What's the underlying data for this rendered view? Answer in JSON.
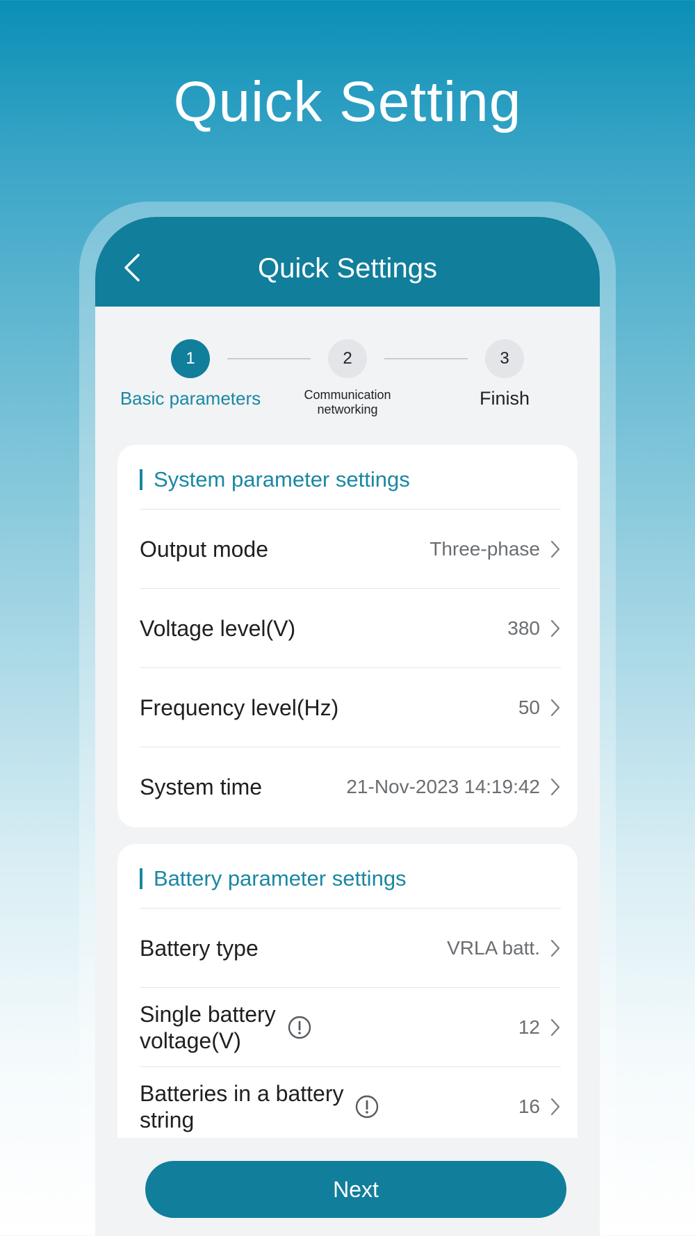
{
  "promo": {
    "title": "Quick Setting"
  },
  "header": {
    "title": "Quick Settings",
    "back_icon": "chevron-left-icon"
  },
  "stepper": {
    "steps": [
      {
        "number": "1",
        "label": "Basic parameters",
        "state": "active"
      },
      {
        "number": "2",
        "label_line1": "Communication",
        "label_line2": "networking",
        "state": "inactive"
      },
      {
        "number": "3",
        "label": "Finish",
        "state": "inactive"
      }
    ]
  },
  "system_card": {
    "title": "System parameter settings",
    "rows": [
      {
        "label": "Output mode",
        "value": "Three-phase"
      },
      {
        "label": "Voltage level(V)",
        "value": "380"
      },
      {
        "label": "Frequency level(Hz)",
        "value": "50"
      },
      {
        "label": "System time",
        "value": "21-Nov-2023 14:19:42"
      }
    ]
  },
  "battery_card": {
    "title": "Battery parameter settings",
    "rows": [
      {
        "label": "Battery type",
        "value": "VRLA batt."
      },
      {
        "label_line1": "Single battery",
        "label_line2": "voltage(V)",
        "value": "12",
        "info_icon": "info-circle-icon"
      },
      {
        "label_line1": "Batteries in a battery",
        "label_line2": "string",
        "value": "16",
        "info_icon": "info-circle-icon"
      }
    ]
  },
  "footer": {
    "next_label": "Next"
  },
  "colors": {
    "primary": "#117e9b",
    "accent_text": "#1a87a3",
    "screen_bg": "#f1f3f5"
  }
}
